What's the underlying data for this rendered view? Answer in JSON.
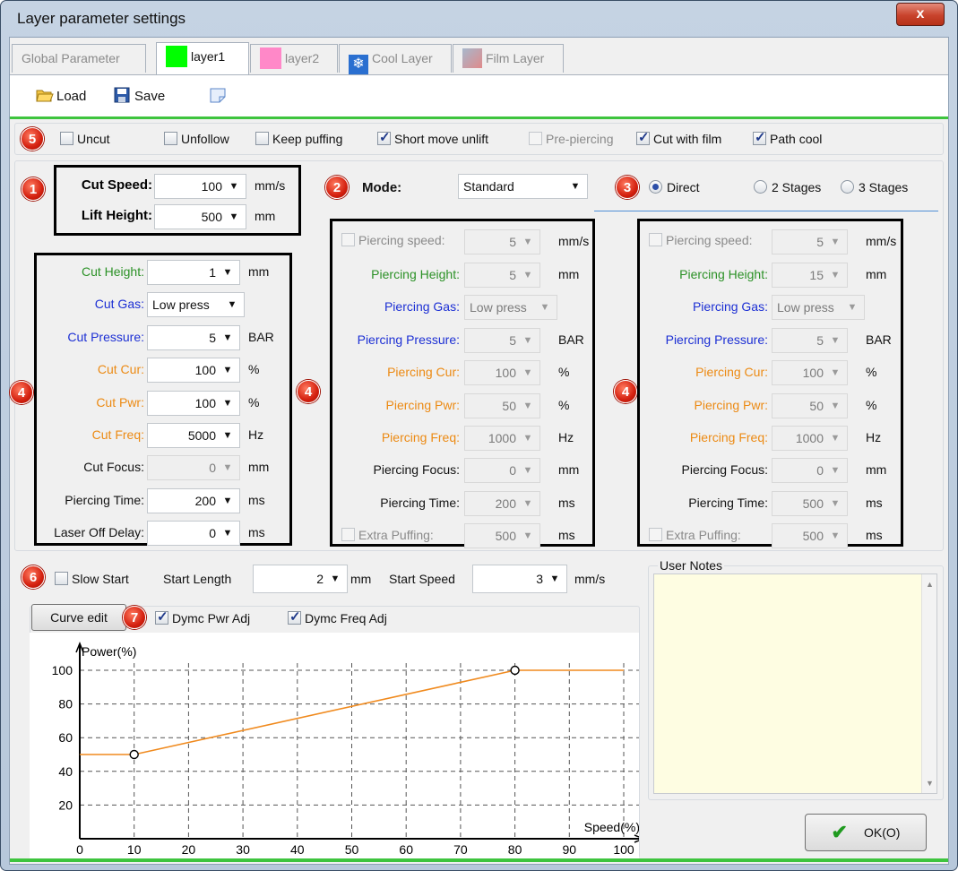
{
  "window": {
    "title": "Layer parameter settings",
    "close_label": "x"
  },
  "tabs": [
    {
      "label": "Global Parameter",
      "color": null,
      "active": false
    },
    {
      "label": "layer1",
      "color": "#00ff00",
      "active": true
    },
    {
      "label": "layer2",
      "color": "#ff88c8",
      "active": false
    },
    {
      "label": "Cool Layer",
      "icon": "snowflake-icon",
      "active": false
    },
    {
      "label": "Film Layer",
      "icon": "film-icon",
      "active": false
    }
  ],
  "toolbar": {
    "load_label": "Load",
    "save_label": "Save"
  },
  "options": {
    "badge": "5",
    "items": [
      {
        "label": "Uncut",
        "checked": false,
        "enabled": true
      },
      {
        "label": "Unfollow",
        "checked": false,
        "enabled": true
      },
      {
        "label": "Keep puffing",
        "checked": false,
        "enabled": true
      },
      {
        "label": "Short move unlift",
        "checked": true,
        "enabled": true
      },
      {
        "label": "Pre-piercing",
        "checked": false,
        "enabled": false
      },
      {
        "label": "Cut with film",
        "checked": true,
        "enabled": true
      },
      {
        "label": "Path cool",
        "checked": true,
        "enabled": true
      }
    ]
  },
  "speed_box": {
    "badge": "1",
    "cut_speed_label": "Cut Speed:",
    "cut_speed_value": "100",
    "cut_speed_unit": "mm/s",
    "lift_height_label": "Lift Height:",
    "lift_height_value": "500",
    "lift_height_unit": "mm"
  },
  "mode": {
    "badge": "2",
    "label": "Mode:",
    "value": "Standard"
  },
  "stages": {
    "badge": "3",
    "direct": "Direct",
    "two": "2 Stages",
    "three": "3 Stages",
    "selected": "Direct"
  },
  "cut_params": {
    "badge": "4",
    "rows": [
      {
        "label": "Cut Height:",
        "value": "1",
        "unit": "mm",
        "color": "green",
        "disabled": false
      },
      {
        "label": "Cut Gas:",
        "value": "Low press",
        "unit": "",
        "color": "blue",
        "disabled": false
      },
      {
        "label": "Cut Pressure:",
        "value": "5",
        "unit": "BAR",
        "color": "blue",
        "disabled": false
      },
      {
        "label": "Cut Cur:",
        "value": "100",
        "unit": "%",
        "color": "orange",
        "disabled": false
      },
      {
        "label": "Cut Pwr:",
        "value": "100",
        "unit": "%",
        "color": "orange",
        "disabled": false
      },
      {
        "label": "Cut Freq:",
        "value": "5000",
        "unit": "Hz",
        "color": "orange",
        "disabled": false
      },
      {
        "label": "Cut Focus:",
        "value": "0",
        "unit": "mm",
        "color": "black",
        "disabled": true
      },
      {
        "label": "Piercing Time:",
        "value": "200",
        "unit": "ms",
        "color": "black",
        "disabled": false
      },
      {
        "label": "Laser Off Delay:",
        "value": "0",
        "unit": "ms",
        "color": "black",
        "disabled": false
      }
    ]
  },
  "pierce1": {
    "badge": "4",
    "speed_label": "Piercing speed:",
    "speed_value": "5",
    "speed_unit": "mm/s",
    "rows": [
      {
        "label": "Piercing Height:",
        "value": "5",
        "unit": "mm",
        "color": "green"
      },
      {
        "label": "Piercing Gas:",
        "value": "Low press",
        "unit": "",
        "color": "blue"
      },
      {
        "label": "Piercing Pressure:",
        "value": "5",
        "unit": "BAR",
        "color": "blue"
      },
      {
        "label": "Piercing Cur:",
        "value": "100",
        "unit": "%",
        "color": "orange"
      },
      {
        "label": "Piercing Pwr:",
        "value": "50",
        "unit": "%",
        "color": "orange"
      },
      {
        "label": "Piercing Freq:",
        "value": "1000",
        "unit": "Hz",
        "color": "orange"
      },
      {
        "label": "Piercing Focus:",
        "value": "0",
        "unit": "mm",
        "color": "black"
      },
      {
        "label": "Piercing Time:",
        "value": "200",
        "unit": "ms",
        "color": "black"
      }
    ],
    "puff_label": "Extra Puffing:",
    "puff_value": "500",
    "puff_unit": "ms"
  },
  "pierce2": {
    "badge": "4",
    "speed_label": "Piercing speed:",
    "speed_value": "5",
    "speed_unit": "mm/s",
    "rows": [
      {
        "label": "Piercing Height:",
        "value": "15",
        "unit": "mm",
        "color": "green"
      },
      {
        "label": "Piercing Gas:",
        "value": "Low press",
        "unit": "",
        "color": "blue"
      },
      {
        "label": "Piercing Pressure:",
        "value": "5",
        "unit": "BAR",
        "color": "blue"
      },
      {
        "label": "Piercing Cur:",
        "value": "100",
        "unit": "%",
        "color": "orange"
      },
      {
        "label": "Piercing Pwr:",
        "value": "50",
        "unit": "%",
        "color": "orange"
      },
      {
        "label": "Piercing Freq:",
        "value": "1000",
        "unit": "Hz",
        "color": "orange"
      },
      {
        "label": "Piercing Focus:",
        "value": "0",
        "unit": "mm",
        "color": "black"
      },
      {
        "label": "Piercing Time:",
        "value": "500",
        "unit": "ms",
        "color": "black"
      }
    ],
    "puff_label": "Extra Puffing:",
    "puff_value": "500",
    "puff_unit": "ms"
  },
  "slow_start": {
    "badge": "6",
    "label": "Slow Start",
    "length_label": "Start Length",
    "length_value": "2",
    "length_unit": "mm",
    "speed_label": "Start Speed",
    "speed_value": "3",
    "speed_unit": "mm/s"
  },
  "curve": {
    "badge": "7",
    "edit_label": "Curve edit",
    "dymc_pwr": "Dymc Pwr Adj",
    "dymc_freq": "Dymc Freq Adj"
  },
  "notes": {
    "label": "User Notes",
    "text": ""
  },
  "ok_label": "OK(O)",
  "colors": {
    "green": "#2b9126",
    "blue": "#1c2fd4",
    "orange": "#ec8a13",
    "line": "#f08a1e",
    "badge": "#d4200f"
  },
  "chart_data": {
    "type": "line",
    "ylabel": "Power(%)",
    "xlabel": "Speed(%)",
    "xlim": [
      0,
      100
    ],
    "ylim": [
      0,
      100
    ],
    "xticks": [
      0,
      10,
      20,
      30,
      40,
      50,
      60,
      70,
      80,
      90,
      100
    ],
    "yticks": [
      20,
      40,
      60,
      80,
      100
    ],
    "grid": true,
    "series": [
      {
        "x": [
          0,
          10,
          80,
          100
        ],
        "y": [
          50,
          50,
          100,
          100
        ],
        "markers": [
          [
            10,
            50
          ],
          [
            80,
            100
          ]
        ]
      }
    ]
  }
}
